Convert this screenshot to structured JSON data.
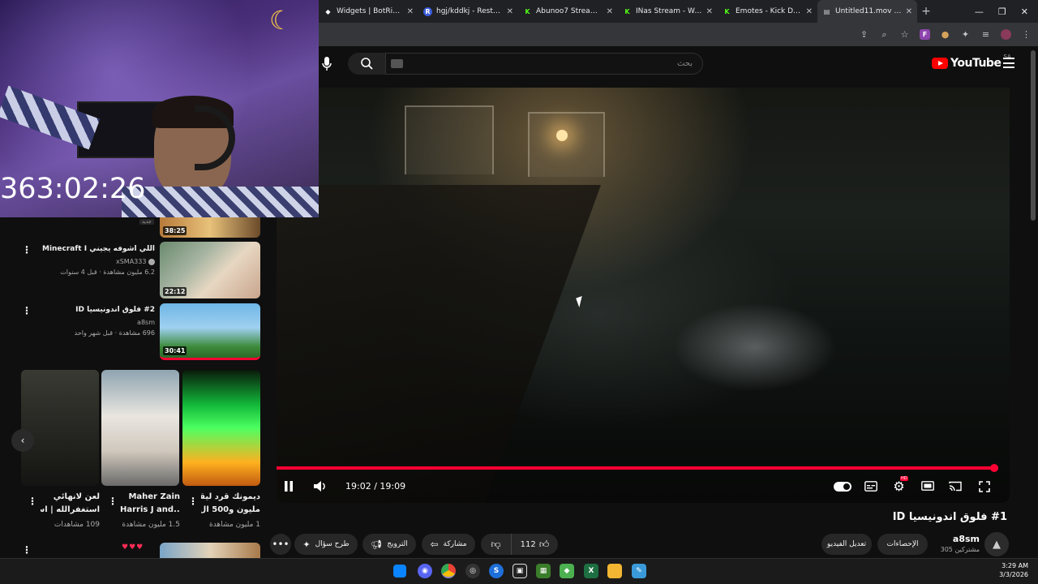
{
  "browser": {
    "tabs": [
      {
        "title": "Widgets | BotRix — C",
        "favicon": "botrix-icon",
        "color": "#ffffff"
      },
      {
        "title": "hgj/kddkj - Restream",
        "favicon": "restream-icon",
        "color": "#3b5bdb"
      },
      {
        "title": "Abunoo7 Stream - W",
        "favicon": "kick-icon",
        "color": "#53fc18"
      },
      {
        "title": "INas Stream - Watch",
        "favicon": "kick-icon",
        "color": "#53fc18"
      },
      {
        "title": "Emotes - Kick Dashb",
        "favicon": "kick-icon",
        "color": "#53fc18"
      },
      {
        "title": "Untitled11.mov - Ani",
        "favicon": "file-icon",
        "color": "#cccccc"
      }
    ],
    "new_tab": "+",
    "ext_f": "F"
  },
  "overlay": {
    "timer": "363:02:26"
  },
  "youtube": {
    "search_placeholder": "بحث",
    "logo_text": "YouTube",
    "country": "SA"
  },
  "player": {
    "time": "19:02 / 19:09",
    "progress_fraction": 0.9947
  },
  "video": {
    "title": "#1 فلوق اندونيسيا ID",
    "channel_name": "a8sm",
    "channel_subs": "305 مشتركين",
    "btn_analytics": "الإحصاءات",
    "btn_edit": "تعديل الفيديو",
    "like_count": "112",
    "btn_share": "مشاركة",
    "btn_promote": "الترويج",
    "btn_ask": "طرح سؤال"
  },
  "recommendations": [
    {
      "title": "اللي اشوفه يجيني Minecraft I",
      "channel": "xSMA333",
      "meta": "6.2 مليون مشاهدة · قبل 4 سنوات",
      "duration": "22:12"
    },
    {
      "title": "#2 فلوق اندونيسيا ID",
      "channel": "a8sm",
      "meta": "696 مشاهدة · قبل شهر واحد",
      "duration": "30:41"
    }
  ],
  "top_partial": {
    "duration": "38:25",
    "badge": "جديد"
  },
  "shorts": [
    {
      "title1": "لعن لانهائي",
      "title2": "استغفرالله  |  اسم...",
      "meta": "109 مشاهدات"
    },
    {
      "title1": "Maher Zain",
      "title2": "Harris J and...",
      "meta": "1.5 مليون مشاهدة"
    },
    {
      "title1": "ديمونك قرد ليقل",
      "title2": "مليون و500 ال...",
      "meta": "1 مليون مشاهدة"
    }
  ],
  "taskbar": {
    "time": "3:29 AM",
    "date": "3/3/2026"
  }
}
